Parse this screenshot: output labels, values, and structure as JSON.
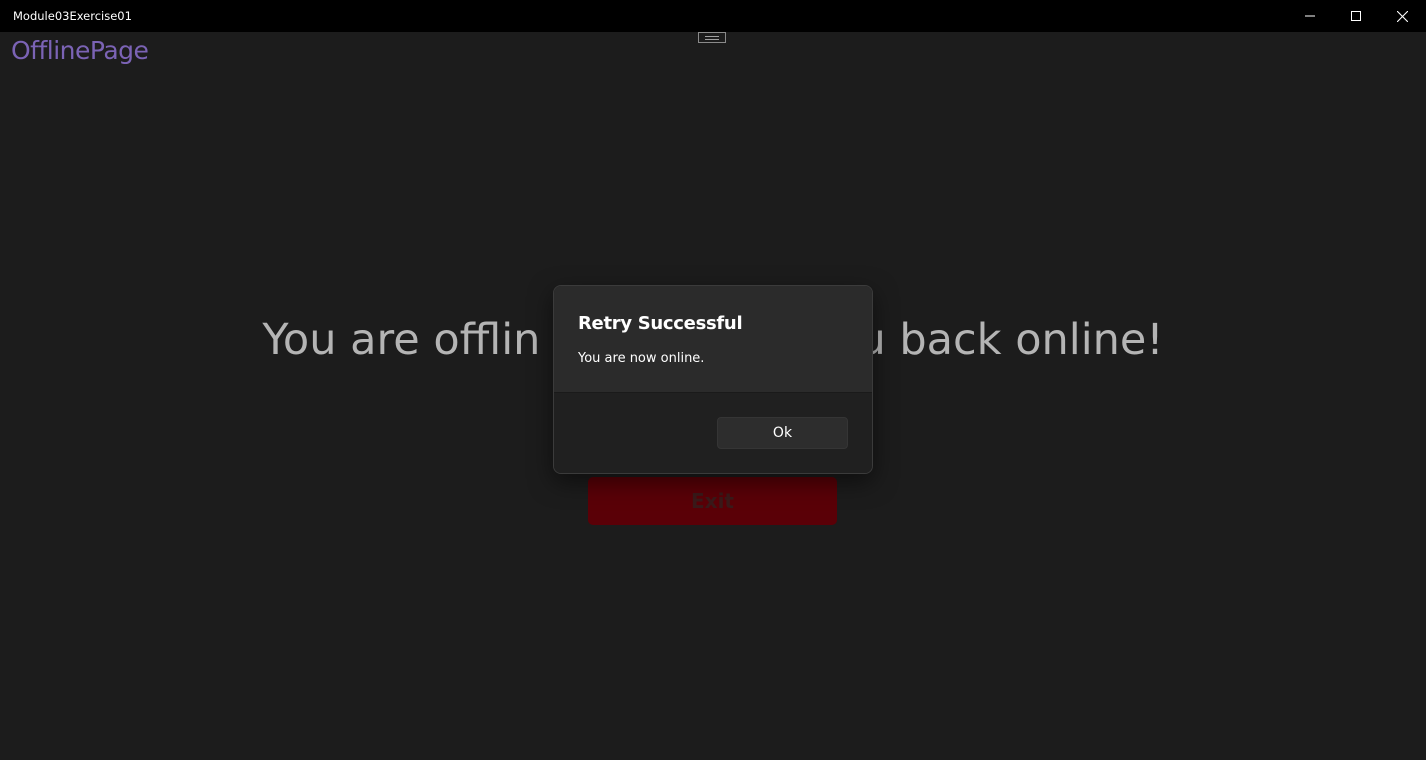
{
  "window": {
    "title": "Module03Exercise01"
  },
  "caption_buttons": {
    "minimize_icon": "minimize-icon",
    "maximize_icon": "maximize-icon",
    "close_icon": "close-icon"
  },
  "page": {
    "title": "OfflinePage",
    "title_color": "#7b63b5",
    "message": "You are offline. We'll let you know when you're back online!",
    "message_visible_left": "You are offlin",
    "message_visible_right": "u back online!",
    "exit_label": "Exit",
    "exit_color": "#5a0007"
  },
  "dialog": {
    "title": "Retry Successful",
    "body": "You are now online.",
    "ok_label": "Ok"
  }
}
